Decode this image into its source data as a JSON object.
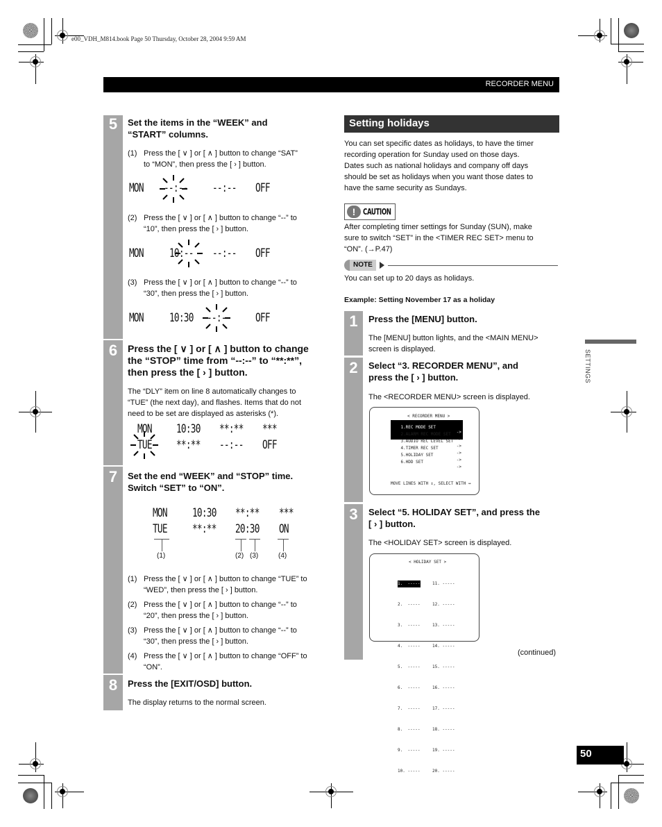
{
  "book_header": "e00_VDH_M814.book  Page 50  Thursday, October 28, 2004  9:59 AM",
  "running_head": "RECORDER MENU",
  "side_tab_label": "SETTINGS",
  "page_number": "50",
  "continued": "(continued)",
  "buttons": {
    "down": "∨",
    "up": "∧",
    "right": "›"
  },
  "left": {
    "step5": {
      "num": "5",
      "title_l1": "Set the items in the “WEEK” and",
      "title_l2": "“START” columns.",
      "subs": [
        {
          "n": "(1)",
          "l1": "Press the [ ∨ ] or [ ∧ ] button to change “SAT”",
          "l2": "to “MON”, then press the [ › ] button.",
          "lcd": [
            "MON",
            "--:--",
            "--:--",
            "OFF"
          ]
        },
        {
          "n": "(2)",
          "l1": "Press the [ ∨ ] or [ ∧ ] button to change “--” to",
          "l2": "“10”, then press the [ › ] button.",
          "lcd": [
            "MON",
            "10:--",
            "--:--",
            "OFF"
          ]
        },
        {
          "n": "(3)",
          "l1": "Press the [ ∨ ] or [ ∧ ] button to change “--” to",
          "l2": "“30”, then press the [ › ] button.",
          "lcd": [
            "MON",
            "10:30",
            "--:--",
            "OFF"
          ]
        }
      ]
    },
    "step6": {
      "num": "6",
      "title_l1": "Press the [ ∨ ] or [ ∧ ] button to change",
      "title_l2": "the “STOP” time from “--:--” to “**:**”,",
      "title_l3": "then press the [ › ] button.",
      "body_l1": "The “DLY” item on line 8 automatically changes to",
      "body_l2": "“TUE” (the next day), and flashes. Items that do not",
      "body_l3": "need to be set are displayed as asterisks (*).",
      "lcd_row1": [
        "MON",
        "10:30",
        "**:**",
        "***"
      ],
      "lcd_row2": [
        "TUE",
        "**:**",
        "--:--",
        "OFF"
      ]
    },
    "step7": {
      "num": "7",
      "title_l1": "Set the end “WEEK” and “STOP” time.",
      "title_l2": "Switch “SET” to “ON”.",
      "lcd_row1": [
        "MON",
        "10:30",
        "**:**",
        "***"
      ],
      "lcd_row2": [
        "TUE",
        "**:**",
        "20:30",
        "ON"
      ],
      "callouts": [
        "(1)",
        "(2)",
        "(3)",
        "(4)"
      ],
      "subs": [
        {
          "n": "(1)",
          "l1": "Press the [ ∨ ] or [ ∧ ] button to change “TUE” to",
          "l2": "“WED”, then press the [ › ] button."
        },
        {
          "n": "(2)",
          "l1": "Press the [ ∨ ] or [ ∧ ] button to change “--” to",
          "l2": "“20”, then press the [ › ] button."
        },
        {
          "n": "(3)",
          "l1": "Press the [ ∨ ] or [ ∧ ] button to change “--” to",
          "l2": "“30”, then press the [ › ] button."
        },
        {
          "n": "(4)",
          "l1": "Press the [ ∨ ] or [ ∧ ] button to change “OFF” to",
          "l2": "“ON”."
        }
      ]
    },
    "step8": {
      "num": "8",
      "title": "Press the [EXIT/OSD] button.",
      "body": "The display returns to the normal screen."
    }
  },
  "right": {
    "section_title": "Setting holidays",
    "intro": [
      "You can set specific dates as holidays, to have the timer",
      "recording operation for Sunday used on those days.",
      "Dates such as national holidays and company off days",
      "should be set as holidays when you want those dates to",
      "have the same security as Sundays."
    ],
    "caution_label": "CAUTION",
    "caution_icon": "!",
    "caution_text": [
      "After completing timer settings for Sunday (SUN), make",
      "sure to switch “SET” in the <TIMER REC SET> menu to",
      "“ON”. (→P.47)"
    ],
    "note_label": "NOTE",
    "note_text": "You can set up to 20 days as holidays.",
    "example_heading": "Example: Setting November 17 as a holiday",
    "step1": {
      "num": "1",
      "title": "Press the [MENU] button.",
      "body_l1": "The [MENU] button lights, and the <MAIN MENU>",
      "body_l2": "screen is displayed."
    },
    "step2": {
      "num": "2",
      "title_l1": "Select “3. RECORDER MENU”, and",
      "title_l2": "press the [ › ] button.",
      "body": "The <RECORDER MENU> screen is displayed."
    },
    "step3": {
      "num": "3",
      "title_l1": "Select “5. HOLIDAY SET”, and press the",
      "title_l2": "[ › ] button.",
      "body": "The <HOLIDAY SET> screen is displayed."
    },
    "recorder_menu_screen": {
      "title": "< RECORDER MENU >",
      "items": [
        {
          "label": "1.REC MODE SET",
          "arrow": "->",
          "selected": true
        },
        {
          "label": "2.ALARM REC MODE SET",
          "arrow": "->"
        },
        {
          "label": "3.AUDIO REC LEVEL SET",
          "arrow": "->"
        },
        {
          "label": "4.TIMER REC SET",
          "arrow": "->"
        },
        {
          "label": "5.HOLIDAY SET",
          "arrow": "->"
        },
        {
          "label": "6.HDD SET",
          "arrow": "->"
        }
      ],
      "footer": "MOVE LINES WITH ↕, SELECT WITH ↔"
    },
    "holiday_screen": {
      "title": "< HOLIDAY SET >",
      "col1": [
        "1.  -----",
        "2.  -----",
        "3.  -----",
        "4.  -----",
        "5.  -----",
        "6.  -----",
        "7.  -----",
        "8.  -----",
        "9.  -----",
        "10. -----"
      ],
      "col2": [
        "11. -----",
        "12. -----",
        "13. -----",
        "14. -----",
        "15. -----",
        "16. -----",
        "17. -----",
        "18. -----",
        "19. -----",
        "20. -----"
      ]
    }
  }
}
